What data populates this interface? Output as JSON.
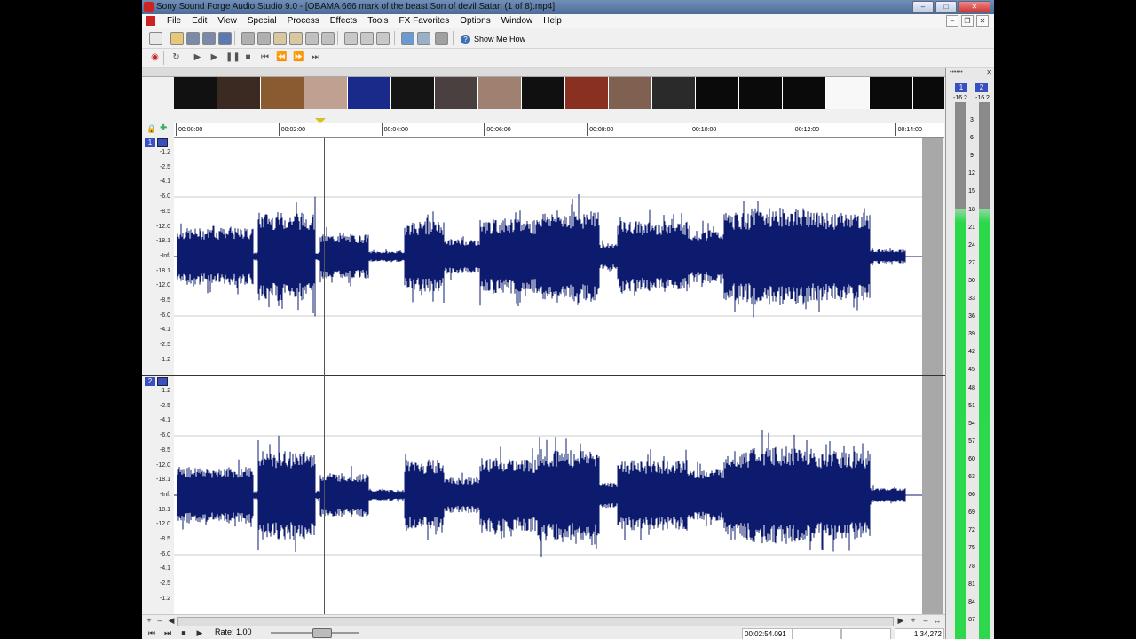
{
  "window": {
    "title": "Sony Sound Forge Audio Studio 9.0 - [OBAMA 666 mark of the beast Son of devil Satan (1 of 8).mp4]"
  },
  "menu": [
    "File",
    "Edit",
    "View",
    "Special",
    "Process",
    "Effects",
    "Tools",
    "FX Favorites",
    "Options",
    "Window",
    "Help"
  ],
  "toolbar": {
    "show_me_how_label": "Show Me How",
    "icons": [
      "new-icon",
      "open-icon",
      "save-icon",
      "save-as-icon",
      "properties-icon",
      "cut-icon",
      "copy-icon",
      "paste-icon",
      "paste-special-icon",
      "mix-icon",
      "trim-icon",
      "undo-icon",
      "redo-icon",
      "repeat-icon",
      "edit-tool-icon",
      "magnify-tool-icon",
      "pencil-tool-icon"
    ],
    "transport_icons": [
      "record-icon",
      "loop-icon",
      "play-all-icon",
      "play-icon",
      "pause-icon",
      "stop-icon",
      "go-to-start-icon",
      "rewind-icon",
      "forward-icon",
      "go-to-end-icon"
    ]
  },
  "timeline": {
    "ticks": [
      "00:00:00",
      "00:02:00",
      "00:04:00",
      "00:06:00",
      "00:08:00",
      "00:10:00",
      "00:12:00",
      "00:14:00"
    ]
  },
  "channels": [
    {
      "label": "1",
      "scale": [
        "-1.2",
        "-2.5",
        "-4.1",
        "-6.0",
        "-8.5",
        "-12.0",
        "-18.1",
        "-Inf.",
        "-18.1",
        "-12.0",
        "-8.5",
        "-6.0",
        "-4.1",
        "-2.5",
        "-1.2"
      ]
    },
    {
      "label": "2",
      "scale": [
        "-1.2",
        "-2.5",
        "-4.1",
        "-6.0",
        "-8.5",
        "-12.0",
        "-18.1",
        "-Inf.",
        "-18.1",
        "-12.0",
        "-8.5",
        "-6.0",
        "-4.1",
        "-2.5",
        "-1.2"
      ]
    }
  ],
  "waveform_color": "#0d1b6e",
  "status": {
    "rate_label": "Rate: 1.00",
    "position": "00:02:54.091",
    "length": "1:34,272"
  },
  "meters": {
    "dots": "••••••",
    "channels": [
      {
        "label": "1",
        "peak": "-16.2",
        "level": 0.8
      },
      {
        "label": "2",
        "peak": "-16.2",
        "level": 0.8
      }
    ],
    "scale": [
      "3",
      "6",
      "9",
      "12",
      "15",
      "18",
      "21",
      "24",
      "27",
      "30",
      "33",
      "36",
      "39",
      "42",
      "45",
      "48",
      "51",
      "54",
      "57",
      "60",
      "63",
      "66",
      "69",
      "72",
      "75",
      "78",
      "81",
      "84",
      "87"
    ]
  }
}
